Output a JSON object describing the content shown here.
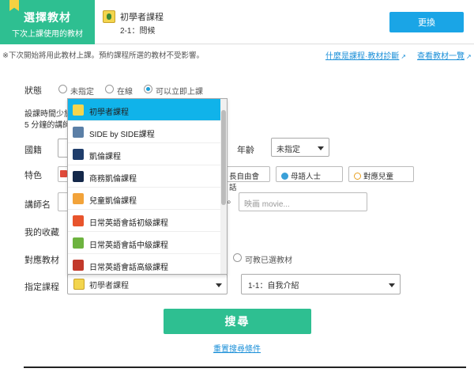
{
  "header": {
    "select_title": "選擇教材",
    "select_subtitle": "下次上課使用的教材",
    "course_name": "初學者課程",
    "course_lesson": "2-1：問候",
    "change_label": "更換"
  },
  "notice": {
    "text": "※下次開始將用此教材上課。預約課程所選的教材不受影響。",
    "link_what": "什麼是課程·教材診斷",
    "link_list": "查看教材一覽"
  },
  "form": {
    "status_label": "狀態",
    "status_options": [
      "未指定",
      "在線",
      "可以立即上課"
    ],
    "time_label_1": "設課時間少於",
    "time_label_2": "5 分鐘的講師",
    "nationality_label": "國籍",
    "age_label": "年齡",
    "age_value": "未指定",
    "feature_label": "特色",
    "feature_chips": [
      "長自由會話",
      "母語人士",
      "對應兒童"
    ],
    "teacher_name_label": "講師名",
    "movie_placeholder": "映画 movie...",
    "favorites_label": "我的收藏",
    "material_label": "對應教材",
    "material_option": "可教已選教材",
    "course_label": "指定課程",
    "course_value": "初學者課程",
    "lesson_value": "1-1：自我介紹",
    "search_label": "搜尋",
    "reset_label": "重置搜尋條件"
  },
  "dropdown": {
    "items": [
      {
        "label": "初學者課程",
        "icon": "beginner-icon",
        "color": "#f3d54e"
      },
      {
        "label": "SIDE by SIDE課程",
        "icon": "side-by-side-icon",
        "color": "#5b7fa6"
      },
      {
        "label": "凱倫課程",
        "icon": "callan-icon",
        "color": "#1f3d6b"
      },
      {
        "label": "商務凱倫課程",
        "icon": "business-callan-icon",
        "color": "#14284a"
      },
      {
        "label": "兒童凱倫課程",
        "icon": "kids-callan-icon",
        "color": "#f2a33a"
      },
      {
        "label": "日常英語會話初級課程",
        "icon": "daily-basic-icon",
        "color": "#e8542c"
      },
      {
        "label": "日常英語會話中級課程",
        "icon": "daily-intermediate-icon",
        "color": "#6db33f"
      },
      {
        "label": "日常英語會話高級課程",
        "icon": "daily-advanced-icon",
        "color": "#c2392b"
      }
    ]
  },
  "colors": {
    "accent": "#2ebf91",
    "button_blue": "#1aa5e6",
    "link": "#1a8fd8",
    "highlight": "#10b3ea"
  }
}
